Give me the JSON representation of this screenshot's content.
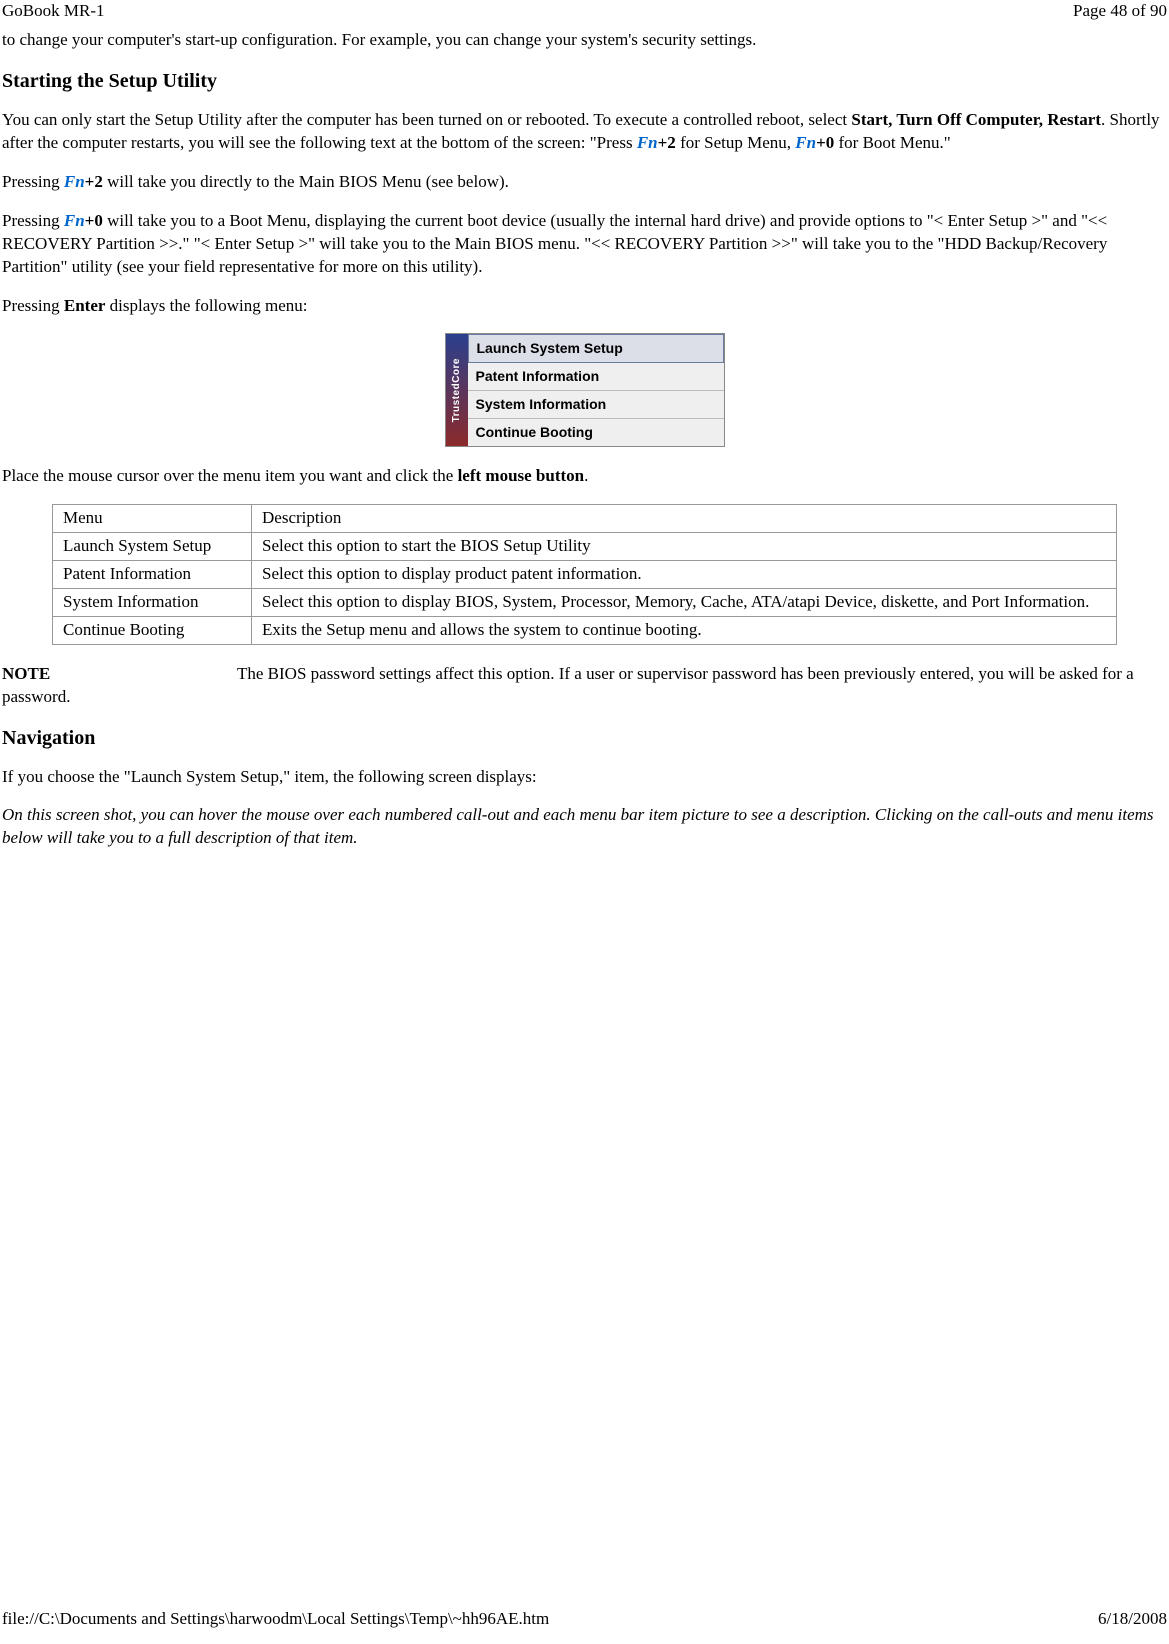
{
  "header": {
    "left": "GoBook MR-1",
    "right": "Page 48 of 90"
  },
  "intro_line": "to change your computer's start-up configuration. For example, you can change your system's security settings.",
  "section1": {
    "heading": "Starting the Setup Utility",
    "p1_prefix": "You can only start the Setup Utility after the computer has been turned on or rebooted. To execute a controlled reboot, select ",
    "p1_bold": "Start, Turn Off Computer, Restart",
    "p1_mid": ". Shortly after the computer restarts, you will see the following text at the bottom of the screen: \"Press ",
    "p1_fn1": "Fn",
    "p1_k1": "+2",
    "p1_sep1": " for Setup Menu, ",
    "p1_fn2": "Fn",
    "p1_k2": "+0",
    "p1_tail": " for Boot Menu.\"",
    "p2_prefix": "Pressing ",
    "p2_fn": "Fn",
    "p2_k": "+2",
    "p2_tail": " will take you directly to the Main BIOS Menu (see below).",
    "p3_prefix": "Pressing ",
    "p3_fn": "Fn",
    "p3_k": "+0",
    "p3_tail": " will take you to a Boot Menu, displaying the current boot device (usually the internal hard drive) and provide options to \"< Enter Setup >\" and  \"<< RECOVERY Partition >>.\"   \"< Enter Setup >\" will take you to the Main BIOS menu.  \"<< RECOVERY Partition >>\" will take you to the \"HDD Backup/Recovery Partition\" utility (see your field representative for more on this utility).",
    "p4_prefix": "Pressing ",
    "p4_bold": "Enter",
    "p4_tail": " displays the following menu:"
  },
  "menu_figure": {
    "side_label": "TrustedCore",
    "items": [
      "Launch System Setup",
      "Patent Information",
      "System Information",
      "Continue Booting"
    ]
  },
  "cursor_line_prefix": "Place the mouse cursor over the menu item you want and click the ",
  "cursor_line_bold": "left mouse button",
  "cursor_line_tail": ".",
  "table": {
    "col1_h": "Menu",
    "col2_h": "Description",
    "rows": [
      {
        "c1": "Launch System Setup",
        "c2": "Select this option to start the BIOS Setup Utility"
      },
      {
        "c1": "Patent Information",
        "c2": "Select this option to display product patent information."
      },
      {
        "c1": "System Information",
        "c2": "Select this option to display BIOS, System, Processor, Memory, Cache, ATA/atapi Device, diskette, and Port Information."
      },
      {
        "c1": "Continue Booting",
        "c2": "Exits the Setup menu and allows the system to continue booting."
      }
    ]
  },
  "note": {
    "label": "NOTE",
    "text": "The BIOS password settings affect this option. If a user or supervisor password has been previously entered, you will be asked for a password."
  },
  "section2": {
    "heading": "Navigation",
    "p1": "If you choose the \"Launch System Setup,\" item, the following screen displays:",
    "p2": "On this screen shot, you can hover the mouse over each numbered call-out and each menu bar item picture to see a description.  Clicking on the call-outs and menu items below will take you to a full description of that item."
  },
  "footer": {
    "left": "file://C:\\Documents and Settings\\harwoodm\\Local Settings\\Temp\\~hh96AE.htm",
    "right": "6/18/2008"
  }
}
